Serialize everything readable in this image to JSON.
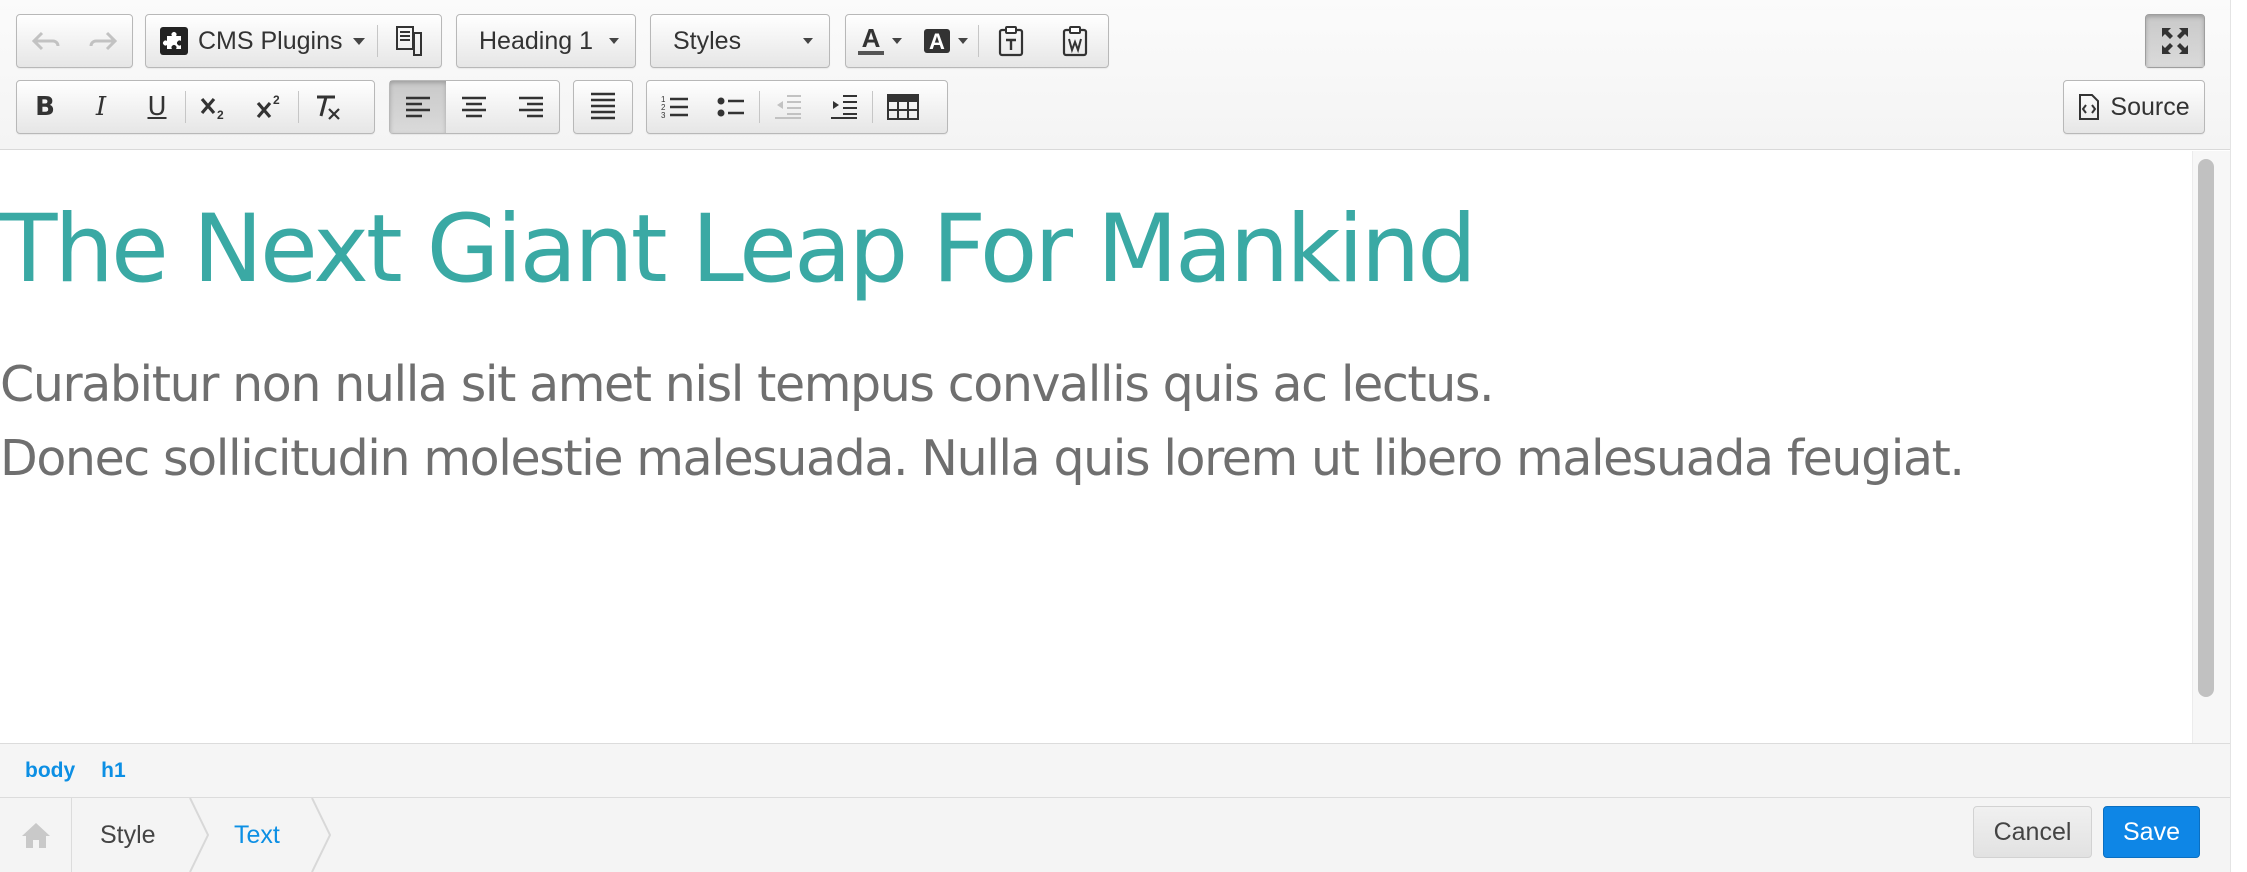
{
  "toolbar": {
    "undo_icon": "undo-arrow-icon",
    "redo_icon": "redo-arrow-icon",
    "cms_plugins_label": "CMS Plugins",
    "format_value": "Heading 1",
    "styles_value": "Styles",
    "source_label": "Source",
    "buttons": [
      "bold",
      "italic",
      "underline",
      "subscript",
      "superscript",
      "remove-format",
      "align-left",
      "align-center",
      "align-right",
      "justify",
      "numbered-list",
      "bulleted-list",
      "outdent",
      "indent",
      "table",
      "text-color",
      "background-color",
      "paste-as-text",
      "paste-from-word",
      "maximize"
    ],
    "active_alignment": "left"
  },
  "content": {
    "heading": "The Next Giant Leap For Mankind",
    "paragraph_lines": [
      "Curabitur non nulla sit amet nisl tempus convallis quis ac lectus.",
      "Donec sollicitudin molestie malesuada. Nulla quis lorem ut libero malesuada feugiat."
    ]
  },
  "element_path": [
    "body",
    "h1"
  ],
  "breadcrumb": {
    "home_icon": "home-icon",
    "items": [
      "Style",
      "Text"
    ]
  },
  "actions": {
    "cancel": "Cancel",
    "save": "Save"
  },
  "colors": {
    "heading": "#3aa9a4",
    "body_text": "#6f6f6f",
    "link": "#0c8fe4",
    "save_button": "#0e86e6"
  }
}
